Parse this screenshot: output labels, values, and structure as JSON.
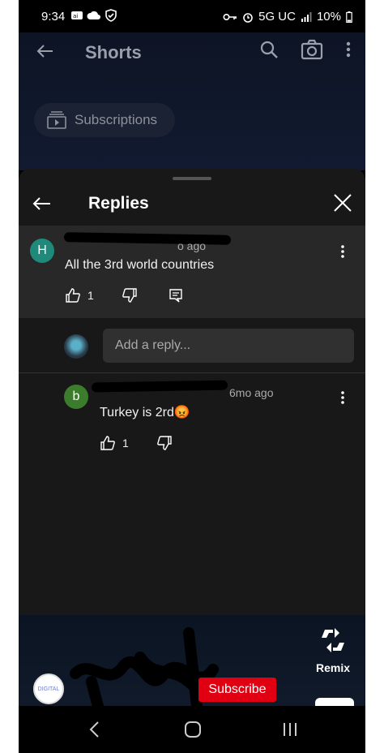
{
  "status": {
    "time": "9:34",
    "network": "5G UC",
    "battery": "10%",
    "icons_left": [
      "notification-badge-icon",
      "cloud-icon",
      "shield-check-icon"
    ],
    "icons_right": [
      "key-icon",
      "alarm-icon",
      "signal-icon",
      "battery-icon"
    ]
  },
  "topbar": {
    "title": "Shorts",
    "icons": [
      "back-arrow-icon",
      "search-icon",
      "camera-icon",
      "kebab-menu-icon"
    ]
  },
  "subscriptions_pill": {
    "label": "Subscriptions",
    "icon": "subscriptions-icon"
  },
  "replies_sheet": {
    "title": "Replies",
    "parent_comment": {
      "avatar_letter": "H",
      "avatar_color": "#1f8a7a",
      "time_suffix": "o ago",
      "text": "All the 3rd world countries",
      "likes": "1"
    },
    "reply_input": {
      "placeholder": "Add a reply..."
    },
    "replies": [
      {
        "avatar_letter": "b",
        "avatar_color": "#3b7d2c",
        "time": "6mo ago",
        "text": "Turkey is 2rd😡",
        "likes": "1"
      }
    ]
  },
  "bottom": {
    "remix_label": "Remix",
    "subscribe_label": "Subscribe",
    "channel_avatar_text": "DIGITAL"
  },
  "navbar": {
    "icons": [
      "nav-back-icon",
      "nav-home-icon",
      "nav-recents-icon"
    ]
  }
}
